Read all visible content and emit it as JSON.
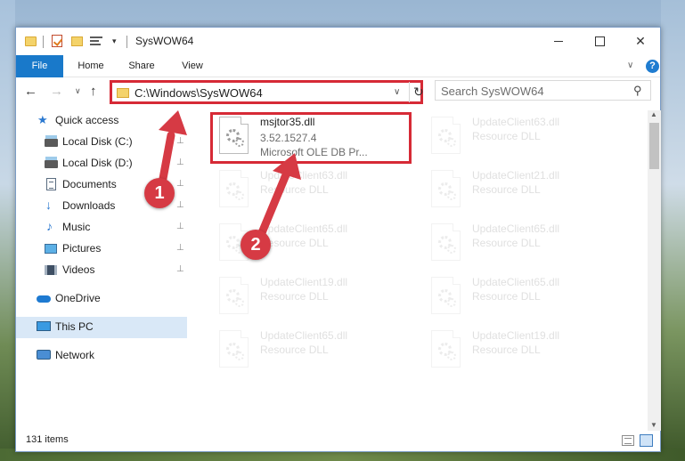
{
  "window": {
    "title": "SysWOW64",
    "close_glyph": "✕"
  },
  "ribbon": {
    "tabs": [
      "File",
      "Home",
      "Share",
      "View"
    ],
    "help": "?",
    "chevron": "∨"
  },
  "nav": {
    "back": "←",
    "forward": "→",
    "recent": "∨",
    "up": "↑",
    "address": "C:\\Windows\\SysWOW64",
    "address_dropdown": "∨",
    "refresh": "↻",
    "search_placeholder": "Search SysWOW64",
    "search_glyph": "⚲"
  },
  "sidebar": {
    "items": [
      {
        "label": "Quick access",
        "icon": "star-icon",
        "pinned": false
      },
      {
        "label": "Local Disk (C:)",
        "icon": "disk-icon",
        "pinned": true
      },
      {
        "label": "Local Disk (D:)",
        "icon": "disk-icon",
        "pinned": true
      },
      {
        "label": "Documents",
        "icon": "documents-icon",
        "pinned": true
      },
      {
        "label": "Downloads",
        "icon": "download-icon",
        "pinned": true
      },
      {
        "label": "Music",
        "icon": "music-icon",
        "pinned": true
      },
      {
        "label": "Pictures",
        "icon": "pictures-icon",
        "pinned": true
      },
      {
        "label": "Videos",
        "icon": "videos-icon",
        "pinned": true
      },
      {
        "label": "OneDrive",
        "icon": "onedrive-icon",
        "pinned": false
      },
      {
        "label": "This PC",
        "icon": "pc-icon",
        "pinned": false,
        "selected": true
      },
      {
        "label": "Network",
        "icon": "network-icon",
        "pinned": false
      }
    ],
    "pin_glyph": "📌"
  },
  "files": [
    {
      "name": "msjtor35.dll",
      "version": "3.52.1527.4",
      "description": "Microsoft OLE DB Pr...",
      "highlighted": true
    },
    {
      "name": "UpdateClient63.dll",
      "description": "Resource DLL"
    },
    {
      "name": "UpdateClient63.dll",
      "description": "Resource DLL"
    },
    {
      "name": "UpdateClient21.dll",
      "description": "Resource DLL"
    },
    {
      "name": "UpdateClient65.dll",
      "description": "Resource DLL"
    },
    {
      "name": "UpdateClient65.dll",
      "description": "Resource DLL"
    },
    {
      "name": "UpdateClient19.dll",
      "description": "Resource DLL"
    },
    {
      "name": "UpdateClient65.dll",
      "description": "Resource DLL"
    },
    {
      "name": "UpdateClient65.dll",
      "description": "Resource DLL"
    },
    {
      "name": "UpdateClient19.dll",
      "description": "Resource DLL"
    }
  ],
  "status": {
    "item_count": "131 items"
  },
  "annotations": {
    "step1": "1",
    "step2": "2",
    "highlight_color": "#d62a36"
  },
  "colors": {
    "accent": "#1979ca",
    "selection": "#d9e8f7"
  }
}
